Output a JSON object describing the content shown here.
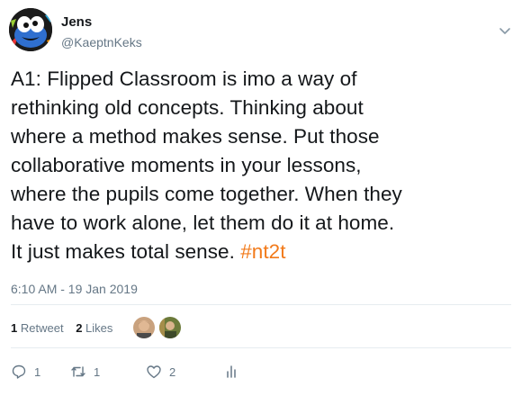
{
  "author": {
    "name": "Jens",
    "handle": "@KaeptnKeks"
  },
  "tweet": {
    "text": "A1: Flipped Classroom is imo a way of\nrethinking old concepts. Thinking  about\nwhere a method makes sense. Put those\ncollaborative moments in  your lessons,\nwhere the pupils come together. When they\nhave to work  alone, let them do it at home.\nIt just makes total sense.  ",
    "hashtag": "#nt2t",
    "timestamp": "6:10 AM - 19 Jan 2019"
  },
  "stats": {
    "retweet_count": "1",
    "retweet_label": "Retweet",
    "like_count": "2",
    "like_label": "Likes"
  },
  "actions": {
    "reply_count": "1",
    "retweet_count": "1",
    "like_count": "2"
  },
  "colors": {
    "hashtag": "#f27a1a",
    "muted": "#657786",
    "divider": "#e6ecf0"
  }
}
